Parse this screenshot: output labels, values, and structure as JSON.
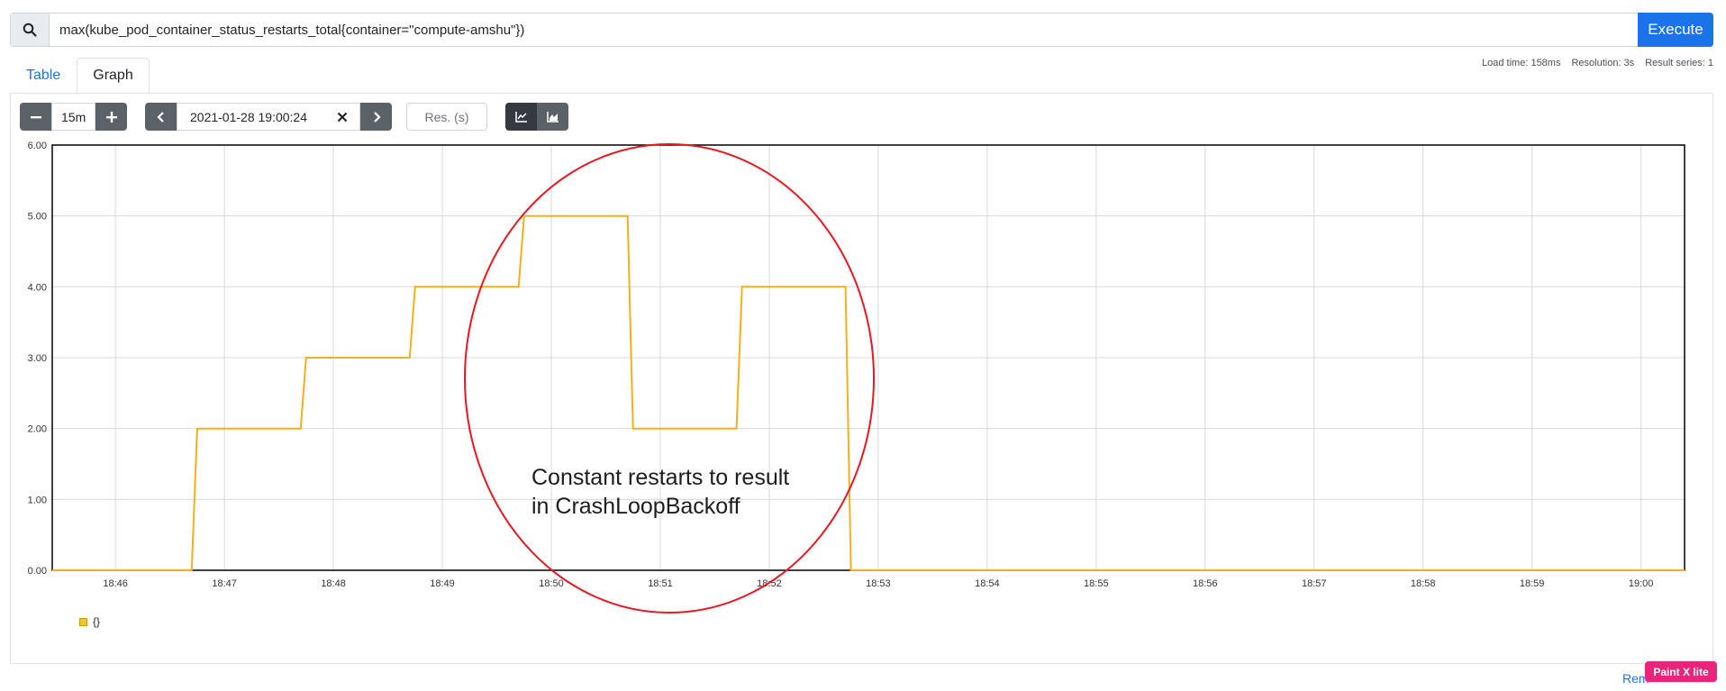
{
  "query": {
    "value": "max(kube_pod_container_status_restarts_total{container=\"compute-amshu\"})",
    "execute_label": "Execute"
  },
  "tabs": [
    {
      "label": "Table",
      "active": false
    },
    {
      "label": "Graph",
      "active": true
    }
  ],
  "stats": {
    "load_time": "Load time: 158ms",
    "resolution": "Resolution: 3s",
    "result_series": "Result series: 1"
  },
  "controls": {
    "minus_icon": "minus-icon",
    "range": "15m",
    "plus_icon": "plus-icon",
    "end_time": "2021-01-28 19:00:24",
    "resolution_placeholder": "Res. (s)",
    "stacked": false
  },
  "annotation": {
    "line1": "Constant restarts to result",
    "line2": "in CrashLoopBackoff",
    "color": "#e8161e"
  },
  "legend": {
    "label": "{}"
  },
  "footer": {
    "remove_label": "Rem",
    "badge": "Paint X lite"
  },
  "chart_data": {
    "type": "line",
    "x_ticks": [
      "18:46",
      "18:47",
      "18:48",
      "18:49",
      "18:50",
      "18:51",
      "18:52",
      "18:53",
      "18:54",
      "18:55",
      "18:56",
      "18:57",
      "18:58",
      "18:59",
      "19:00"
    ],
    "y_ticks": [
      "0.00",
      "1.00",
      "2.00",
      "3.00",
      "4.00",
      "5.00",
      "6.00"
    ],
    "ylim": [
      0,
      6
    ],
    "xlim_minutes": [
      45.42,
      60.4
    ],
    "grid": true,
    "series": [
      {
        "color": "#f2b01d",
        "points": [
          [
            45.42,
            0
          ],
          [
            46.7,
            0
          ],
          [
            46.75,
            2
          ],
          [
            47.7,
            2
          ],
          [
            47.75,
            3
          ],
          [
            48.7,
            3
          ],
          [
            48.75,
            4
          ],
          [
            49.7,
            4
          ],
          [
            49.75,
            5
          ],
          [
            50.7,
            5
          ],
          [
            50.75,
            2
          ],
          [
            51.7,
            2
          ],
          [
            51.75,
            4
          ],
          [
            52.7,
            4
          ],
          [
            52.75,
            0
          ],
          [
            60.4,
            0
          ]
        ]
      }
    ]
  }
}
